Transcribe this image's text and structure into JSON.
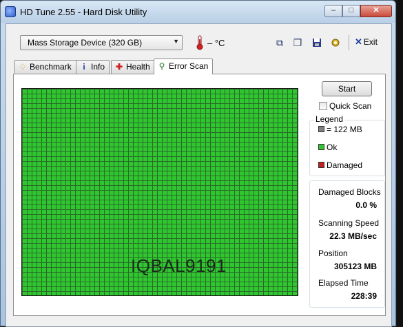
{
  "window": {
    "title": "HD Tune 2.55 - Hard Disk Utility",
    "minimize": "–",
    "maximize": "□",
    "close": "✕"
  },
  "toolbar": {
    "drive_select": "Mass Storage Device (320 GB)",
    "temperature": "– °C",
    "exit_label": "Exit",
    "icons": [
      "copy-icon",
      "copy-info-icon",
      "save-icon",
      "options-icon",
      "exit-icon"
    ]
  },
  "tabs": [
    {
      "label": "Benchmark",
      "icon": "benchmark-icon",
      "active": false
    },
    {
      "label": "Info",
      "icon": "info-icon",
      "active": false
    },
    {
      "label": "Health",
      "icon": "health-icon",
      "active": false
    },
    {
      "label": "Error Scan",
      "icon": "magnifier-icon",
      "active": true
    }
  ],
  "scan": {
    "watermark": "IQBAL9191",
    "block_color": "#2fc62f",
    "start_label": "Start",
    "quick_scan_label": "Quick Scan",
    "quick_scan_checked": false
  },
  "legend": {
    "title": "Legend",
    "items": [
      {
        "label": "= 122 MB",
        "color": "#808080"
      },
      {
        "label": "Ok",
        "color": "#2fc62f"
      },
      {
        "label": "Damaged",
        "color": "#c02020"
      }
    ]
  },
  "stats": {
    "damaged_blocks_label": "Damaged Blocks",
    "damaged_blocks_value": "0.0 %",
    "scanning_speed_label": "Scanning Speed",
    "scanning_speed_value": "22.3 MB/sec",
    "position_label": "Position",
    "position_value": "305123 MB",
    "elapsed_label": "Elapsed Time",
    "elapsed_value": "228:39"
  }
}
